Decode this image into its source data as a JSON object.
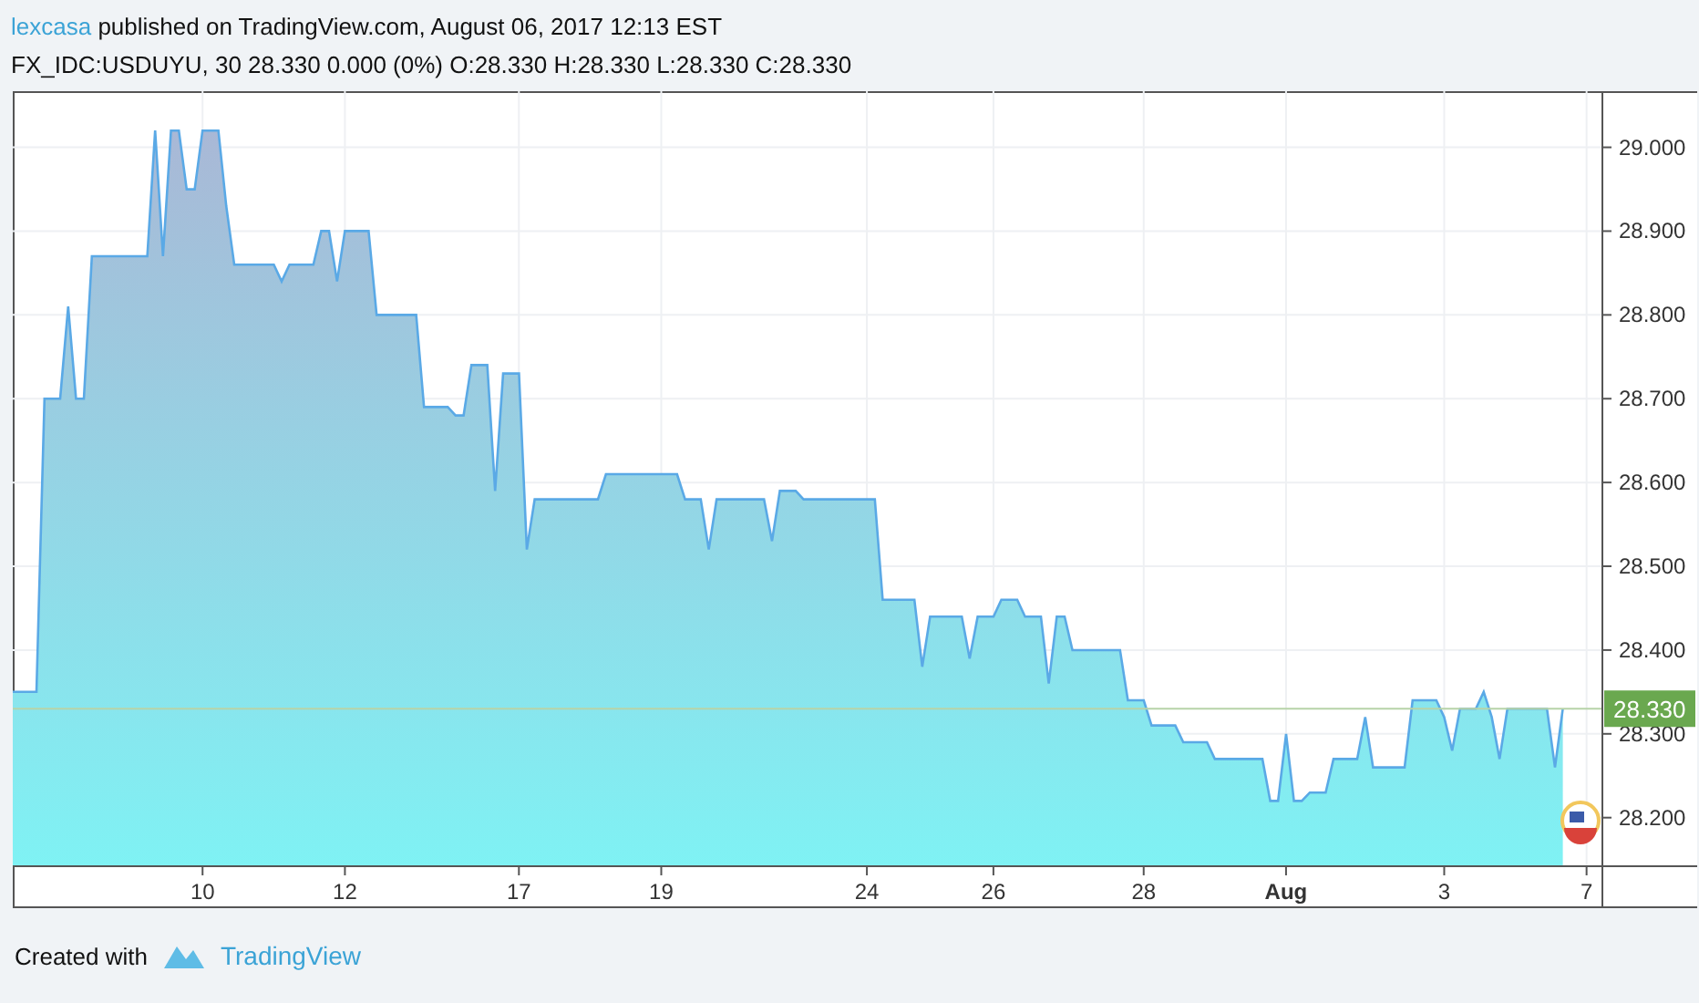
{
  "header": {
    "author": "lexcasa",
    "published": "published on TradingView.com, August 06, 2017 12:13 EST",
    "symbol_line": "FX_IDC:USDUYU, 30  28.330 0.000 (0%) O:28.330 H:28.330 L:28.330 C:28.330"
  },
  "chart": {
    "last_price": "28.330",
    "chart_data": {
      "type": "area",
      "grid": true,
      "ref_lines": [
        {
          "axis": "y",
          "value": 28.33,
          "color": "#b7d3a8"
        }
      ],
      "ylim": [
        28.142,
        29.067
      ],
      "yticks": [
        {
          "value": 28.2,
          "label": "28.200"
        },
        {
          "value": 28.3,
          "label": "28.300"
        },
        {
          "value": 28.4,
          "label": "28.400"
        },
        {
          "value": 28.5,
          "label": "28.500"
        },
        {
          "value": 28.6,
          "label": "28.600"
        },
        {
          "value": 28.7,
          "label": "28.700"
        },
        {
          "value": 28.8,
          "label": "28.800"
        },
        {
          "value": 28.9,
          "label": "28.900"
        },
        {
          "value": 29.0,
          "label": "29.000"
        }
      ],
      "categories": [
        null,
        null,
        null,
        null,
        null,
        null,
        null,
        null,
        null,
        null,
        null,
        null,
        null,
        null,
        null,
        null,
        null,
        null,
        null,
        null,
        null,
        null,
        null,
        null,
        "10",
        null,
        null,
        null,
        null,
        null,
        null,
        null,
        null,
        null,
        null,
        null,
        null,
        null,
        null,
        null,
        null,
        null,
        "12",
        null,
        null,
        null,
        null,
        null,
        null,
        null,
        null,
        null,
        null,
        null,
        null,
        null,
        null,
        null,
        null,
        null,
        null,
        null,
        null,
        null,
        "17",
        null,
        null,
        null,
        null,
        null,
        null,
        null,
        null,
        null,
        null,
        null,
        null,
        null,
        null,
        null,
        null,
        null,
        "19",
        null,
        null,
        null,
        null,
        null,
        null,
        null,
        null,
        null,
        null,
        null,
        null,
        null,
        null,
        null,
        null,
        null,
        null,
        null,
        null,
        null,
        null,
        null,
        null,
        null,
        "24",
        null,
        null,
        null,
        null,
        null,
        null,
        null,
        null,
        null,
        null,
        null,
        null,
        null,
        null,
        null,
        "26",
        null,
        null,
        null,
        null,
        null,
        null,
        null,
        null,
        null,
        null,
        null,
        null,
        null,
        null,
        null,
        null,
        null,
        null,
        "28",
        null,
        null,
        null,
        null,
        null,
        null,
        null,
        null,
        null,
        null,
        null,
        null,
        null,
        null,
        null,
        null,
        null,
        "Aug",
        null,
        null,
        null,
        null,
        null,
        null,
        null,
        null,
        null,
        null,
        null,
        null,
        null,
        null,
        null,
        null,
        null,
        null,
        null,
        "3",
        null,
        null,
        null,
        null,
        null,
        null,
        null,
        null,
        null,
        null,
        null,
        null,
        null,
        null,
        null,
        null,
        null,
        "7",
        null
      ],
      "series": [
        {
          "color": "#5aa9e6",
          "values": [
            28.35,
            28.35,
            28.35,
            28.35,
            28.7,
            28.7,
            28.7,
            28.81,
            28.7,
            28.7,
            28.87,
            28.87,
            28.87,
            28.87,
            28.87,
            28.87,
            28.87,
            28.87,
            29.02,
            28.87,
            29.02,
            29.02,
            28.95,
            28.95,
            29.02,
            29.02,
            29.02,
            28.93,
            28.86,
            28.86,
            28.86,
            28.86,
            28.86,
            28.86,
            28.84,
            28.86,
            28.86,
            28.86,
            28.86,
            28.9,
            28.9,
            28.84,
            28.9,
            28.9,
            28.9,
            28.9,
            28.8,
            28.8,
            28.8,
            28.8,
            28.8,
            28.8,
            28.69,
            28.69,
            28.69,
            28.69,
            28.68,
            28.68,
            28.74,
            28.74,
            28.74,
            28.59,
            28.73,
            28.73,
            28.73,
            28.52,
            28.58,
            28.58,
            28.58,
            28.58,
            28.58,
            28.58,
            28.58,
            28.58,
            28.58,
            28.61,
            28.61,
            28.61,
            28.61,
            28.61,
            28.61,
            28.61,
            28.61,
            28.61,
            28.61,
            28.58,
            28.58,
            28.58,
            28.52,
            28.58,
            28.58,
            28.58,
            28.58,
            28.58,
            28.58,
            28.58,
            28.53,
            28.59,
            28.59,
            28.59,
            28.58,
            28.58,
            28.58,
            28.58,
            28.58,
            28.58,
            28.58,
            28.58,
            28.58,
            28.58,
            28.46,
            28.46,
            28.46,
            28.46,
            28.46,
            28.38,
            28.44,
            28.44,
            28.44,
            28.44,
            28.44,
            28.39,
            28.44,
            28.44,
            28.44,
            28.46,
            28.46,
            28.46,
            28.44,
            28.44,
            28.44,
            28.36,
            28.44,
            28.44,
            28.4,
            28.4,
            28.4,
            28.4,
            28.4,
            28.4,
            28.4,
            28.34,
            28.34,
            28.34,
            28.31,
            28.31,
            28.31,
            28.31,
            28.29,
            28.29,
            28.29,
            28.29,
            28.27,
            28.27,
            28.27,
            28.27,
            28.27,
            28.27,
            28.27,
            28.22,
            28.22,
            28.3,
            28.22,
            28.22,
            28.23,
            28.23,
            28.23,
            28.27,
            28.27,
            28.27,
            28.27,
            28.32,
            28.26,
            28.26,
            28.26,
            28.26,
            28.26,
            28.34,
            28.34,
            28.34,
            28.34,
            28.32,
            28.28,
            28.33,
            28.33,
            28.33,
            28.35,
            28.32,
            28.27,
            28.33,
            28.33,
            28.33,
            28.33,
            28.33,
            28.33,
            28.26,
            28.33,
            null,
            null,
            null,
            null
          ]
        }
      ]
    }
  },
  "footer": {
    "created_with": "Created with",
    "brand": "TradingView"
  }
}
